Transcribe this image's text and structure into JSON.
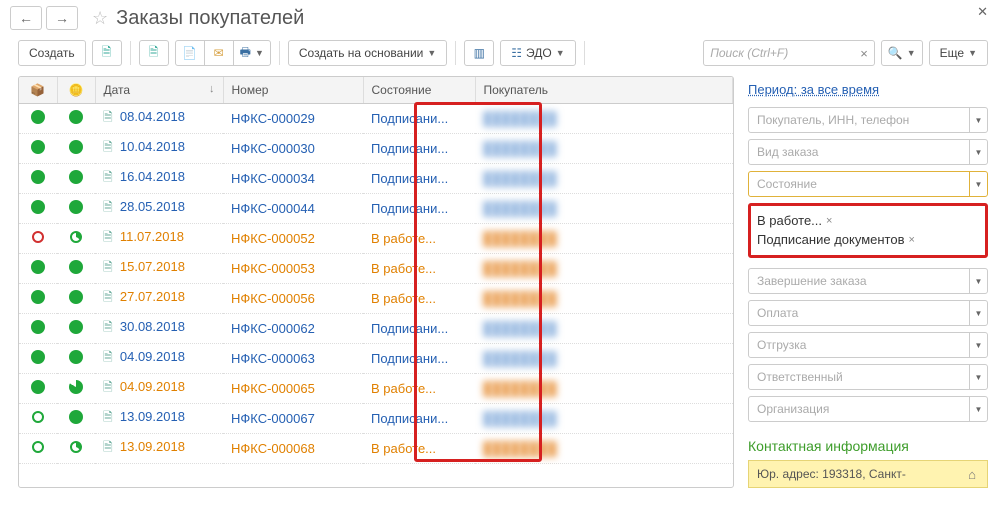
{
  "header": {
    "title": "Заказы покупателей"
  },
  "toolbar": {
    "create": "Создать",
    "createFrom": "Создать на основании",
    "edo": "ЭДО",
    "searchPlaceholder": "Поиск (Ctrl+F)",
    "more": "Еще"
  },
  "columns": {
    "date": "Дата",
    "number": "Номер",
    "state": "Состояние",
    "buyer": "Покупатель"
  },
  "rows": [
    {
      "s1": "filled-green",
      "s2": "filled-green",
      "date": "08.04.2018",
      "num": "НФКС-000029",
      "state": "Подписани...",
      "tone": "blue"
    },
    {
      "s1": "filled-green",
      "s2": "filled-green",
      "date": "10.04.2018",
      "num": "НФКС-000030",
      "state": "Подписани...",
      "tone": "blue"
    },
    {
      "s1": "filled-green",
      "s2": "filled-green",
      "date": "16.04.2018",
      "num": "НФКС-000034",
      "state": "Подписани...",
      "tone": "blue"
    },
    {
      "s1": "filled-green",
      "s2": "filled-green",
      "date": "28.05.2018",
      "num": "НФКС-000044",
      "state": "Подписани...",
      "tone": "blue"
    },
    {
      "s1": "ring-red",
      "s2": "pac-hollow",
      "date": "11.07.2018",
      "num": "НФКС-000052",
      "state": "В работе...",
      "tone": "orange"
    },
    {
      "s1": "filled-green",
      "s2": "filled-green",
      "date": "15.07.2018",
      "num": "НФКС-000053",
      "state": "В работе...",
      "tone": "orange"
    },
    {
      "s1": "filled-green",
      "s2": "filled-green",
      "date": "27.07.2018",
      "num": "НФКС-000056",
      "state": "В работе...",
      "tone": "orange"
    },
    {
      "s1": "filled-green",
      "s2": "filled-green",
      "date": "30.08.2018",
      "num": "НФКС-000062",
      "state": "Подписани...",
      "tone": "blue"
    },
    {
      "s1": "filled-green",
      "s2": "filled-green",
      "date": "04.09.2018",
      "num": "НФКС-000063",
      "state": "Подписани...",
      "tone": "blue"
    },
    {
      "s1": "filled-green",
      "s2": "pac-green",
      "date": "04.09.2018",
      "num": "НФКС-000065",
      "state": "В работе...",
      "tone": "orange"
    },
    {
      "s1": "ring-green",
      "s2": "filled-green",
      "date": "13.09.2018",
      "num": "НФКС-000067",
      "state": "Подписани...",
      "tone": "blue"
    },
    {
      "s1": "ring-green",
      "s2": "pac-hollow",
      "date": "13.09.2018",
      "num": "НФКС-000068",
      "state": "В работе...",
      "tone": "orange"
    }
  ],
  "sidebar": {
    "periodLink": "Период: за все время",
    "filters": {
      "buyer": "Покупатель, ИНН, телефон",
      "orderType": "Вид заказа",
      "state": "Состояние",
      "completion": "Завершение заказа",
      "payment": "Оплата",
      "shipment": "Отгрузка",
      "responsible": "Ответственный",
      "organization": "Организация"
    },
    "tags": [
      "В работе...",
      "Подписание документов"
    ],
    "contactTitle": "Контактная информация",
    "address": "Юр. адрес: 193318, Санкт-"
  }
}
